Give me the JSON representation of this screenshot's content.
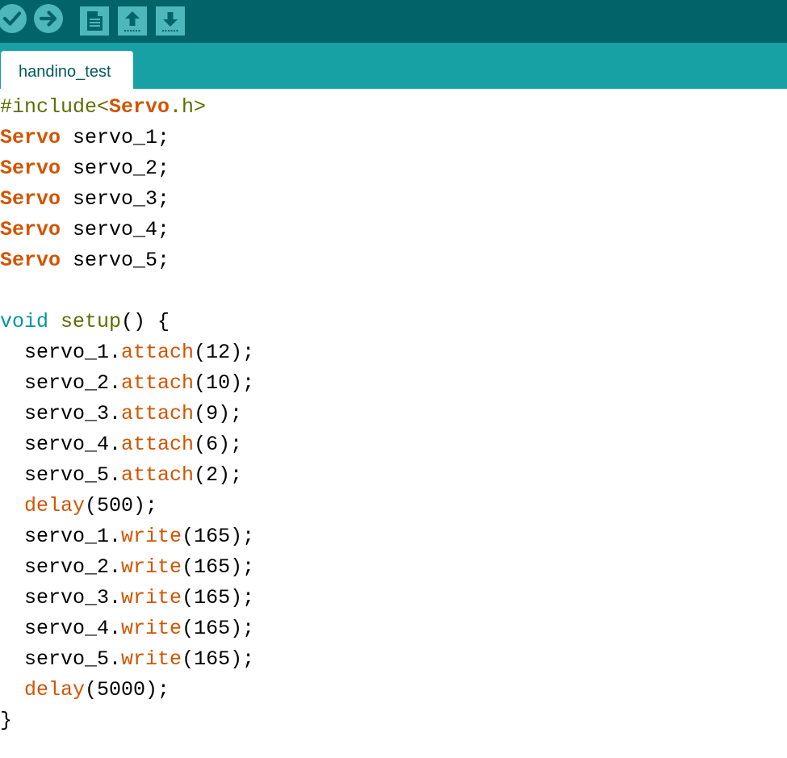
{
  "colors": {
    "toolbar_bg": "#006468",
    "tabbar_bg": "#17a1a5",
    "button_bg": "#4db7bb",
    "button_glyph": "#006468",
    "type_color": "#d35400",
    "keyword_color": "#00979c",
    "preproc_color": "#5e6d03"
  },
  "toolbar": {
    "buttons": [
      {
        "id": "verify",
        "icon": "checkmark-icon"
      },
      {
        "id": "upload",
        "icon": "right-arrow-icon"
      },
      {
        "id": "new",
        "icon": "new-sketch-icon"
      },
      {
        "id": "open",
        "icon": "open-arrow-up-icon"
      },
      {
        "id": "save",
        "icon": "save-arrow-down-icon"
      }
    ]
  },
  "tab": {
    "label": "handino_test"
  },
  "code": {
    "lines": [
      "#include<Servo.h>",
      "Servo servo_1;",
      "Servo servo_2;",
      "Servo servo_3;",
      "Servo servo_4;",
      "Servo servo_5;",
      "",
      "void setup() {",
      "  servo_1.attach(12);",
      "  servo_2.attach(10);",
      "  servo_3.attach(9);",
      "  servo_4.attach(6);",
      "  servo_5.attach(2);",
      "  delay(500);",
      "  servo_1.write(165);",
      "  servo_2.write(165);",
      "  servo_3.write(165);",
      "  servo_4.write(165);",
      "  servo_5.write(165);",
      "  delay(5000);",
      "}"
    ]
  }
}
